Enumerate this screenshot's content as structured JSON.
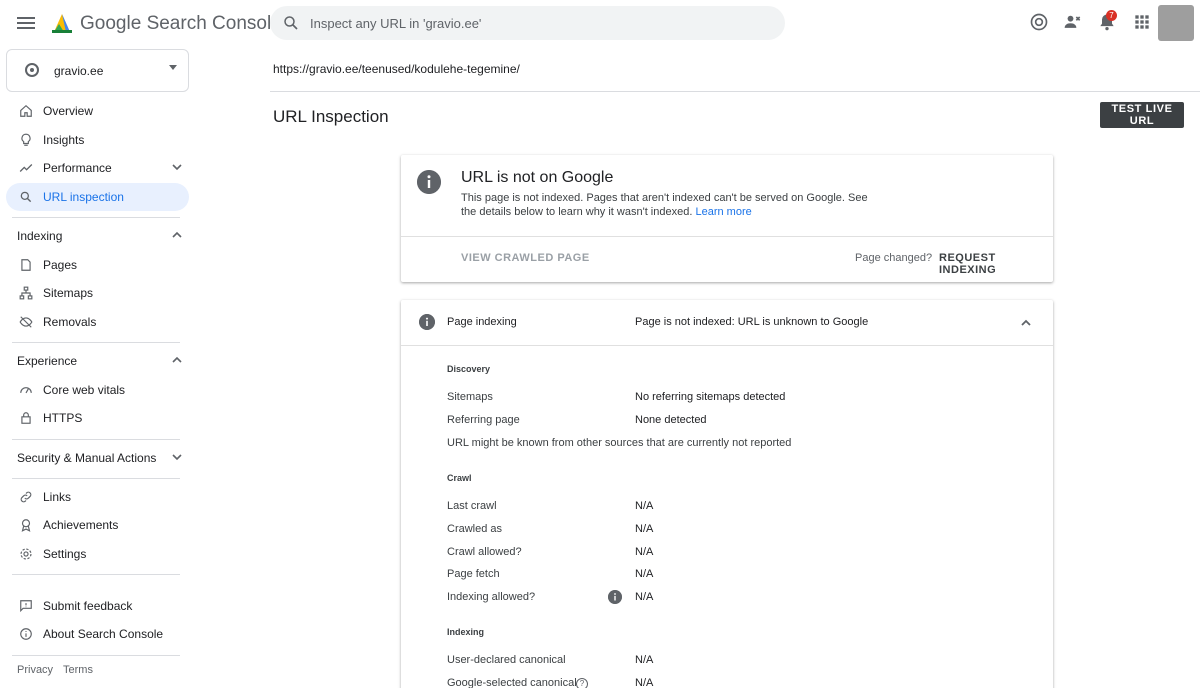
{
  "app": {
    "name_google": "Google",
    "name_product": "Search Console",
    "search_placeholder": "Inspect any URL in 'gravio.ee'",
    "notification_count": "7"
  },
  "sidebar": {
    "property": "gravio.ee",
    "items": {
      "overview": "Overview",
      "insights": "Insights",
      "performance": "Performance",
      "url_inspection": "URL inspection",
      "indexing": "Indexing",
      "pages": "Pages",
      "sitemaps": "Sitemaps",
      "removals": "Removals",
      "experience": "Experience",
      "core_web_vitals": "Core web vitals",
      "https": "HTTPS",
      "security": "Security & Manual Actions",
      "links": "Links",
      "achievements": "Achievements",
      "settings": "Settings",
      "submit_feedback": "Submit feedback",
      "about": "About Search Console"
    },
    "footer": {
      "privacy": "Privacy",
      "terms": "Terms"
    }
  },
  "main": {
    "inspected_url": "https://gravio.ee/teenused/kodulehe-tegemine/",
    "title": "URL Inspection",
    "test_live_button": "TEST LIVE URL",
    "status_card": {
      "title": "URL is not on Google",
      "description": "This page is not indexed. Pages that aren't indexed can't be served on Google. See the details below to learn why it wasn't indexed.",
      "learn_more": "Learn more",
      "view_crawled": "VIEW CRAWLED PAGE",
      "page_changed": "Page changed?",
      "request_indexing": "REQUEST INDEXING"
    },
    "indexing_card": {
      "label": "Page indexing",
      "status": "Page is not indexed: URL is unknown to Google",
      "discovery": {
        "title": "Discovery",
        "sitemaps_label": "Sitemaps",
        "sitemaps_value": "No referring sitemaps detected",
        "referring_label": "Referring page",
        "referring_value": "None detected",
        "note": "URL might be known from other sources that are currently not reported"
      },
      "crawl": {
        "title": "Crawl",
        "rows": [
          {
            "label": "Last crawl",
            "value": "N/A"
          },
          {
            "label": "Crawled as",
            "value": "N/A"
          },
          {
            "label": "Crawl allowed?",
            "value": "N/A"
          },
          {
            "label": "Page fetch",
            "value": "N/A"
          },
          {
            "label": "Indexing allowed?",
            "value": "N/A"
          }
        ]
      },
      "indexing": {
        "title": "Indexing",
        "rows": [
          {
            "label": "User-declared canonical",
            "value": "N/A"
          },
          {
            "label": "Google-selected canonical",
            "value": "N/A"
          }
        ]
      }
    }
  }
}
